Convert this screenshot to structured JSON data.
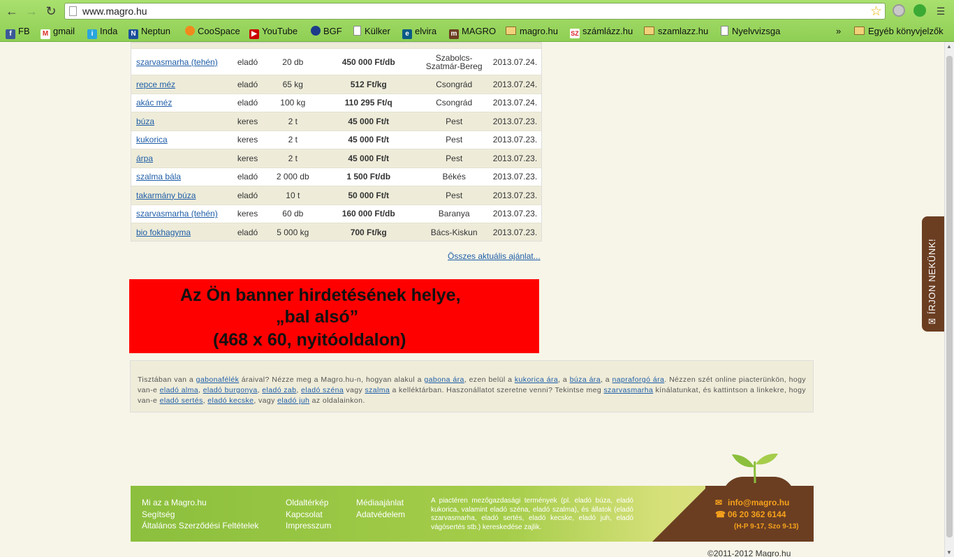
{
  "browser": {
    "url": "www.magro.hu",
    "bookmarks": [
      "FB",
      "gmail",
      "Inda",
      "Neptun",
      "CooSpace",
      "YouTube",
      "BGF",
      "Külker",
      "elvira",
      "MAGRO",
      "magro.hu",
      "számlázz.hu",
      "szamlazz.hu",
      "Nyelvvizsga"
    ],
    "overflow": "»",
    "other_bookmarks": "Egyéb könyvjelzők"
  },
  "listings": [
    {
      "name": "szarvasmarha (tehén)",
      "type": "eladó",
      "qty": "20 db",
      "price": "450 000 Ft/db",
      "region": "Szabolcs-Szatmár-Bereg",
      "date": "2013.07.24."
    },
    {
      "name": "repce méz",
      "type": "eladó",
      "qty": "65 kg",
      "price": "512 Ft/kg",
      "region": "Csongrád",
      "date": "2013.07.24."
    },
    {
      "name": "akác méz",
      "type": "eladó",
      "qty": "100 kg",
      "price": "110 295 Ft/q",
      "region": "Csongrád",
      "date": "2013.07.24."
    },
    {
      "name": "búza",
      "type": "keres",
      "qty": "2 t",
      "price": "45 000 Ft/t",
      "region": "Pest",
      "date": "2013.07.23."
    },
    {
      "name": "kukorica",
      "type": "keres",
      "qty": "2 t",
      "price": "45 000 Ft/t",
      "region": "Pest",
      "date": "2013.07.23."
    },
    {
      "name": "árpa",
      "type": "keres",
      "qty": "2 t",
      "price": "45 000 Ft/t",
      "region": "Pest",
      "date": "2013.07.23."
    },
    {
      "name": "szalma bála",
      "type": "eladó",
      "qty": "2 000 db",
      "price": "1 500 Ft/db",
      "region": "Békés",
      "date": "2013.07.23."
    },
    {
      "name": "takarmány búza",
      "type": "eladó",
      "qty": "10 t",
      "price": "50 000 Ft/t",
      "region": "Pest",
      "date": "2013.07.23."
    },
    {
      "name": "szarvasmarha (tehén)",
      "type": "keres",
      "qty": "60 db",
      "price": "160 000 Ft/db",
      "region": "Baranya",
      "date": "2013.07.23."
    },
    {
      "name": "bio fokhagyma",
      "type": "eladó",
      "qty": "5 000 kg",
      "price": "700 Ft/kg",
      "region": "Bács-Kiskun",
      "date": "2013.07.23."
    }
  ],
  "all_offers_link": "Összes aktuális ajánlat...",
  "banner": {
    "line1": "Az Ön banner hirdetésének helye,",
    "line2": "„bal alsó”",
    "line3": "(468 x 60, nyitóoldalon)"
  },
  "info": [
    {
      "t": "Tisztában van a "
    },
    {
      "l": "gabonafélék"
    },
    {
      "t": " áraival? Nézze meg a Magro.hu-n, hogyan alakul a "
    },
    {
      "l": "gabona ára"
    },
    {
      "t": ", ezen belül a "
    },
    {
      "l": "kukorica ára"
    },
    {
      "t": ", a "
    },
    {
      "l": "búza ára"
    },
    {
      "t": ", a "
    },
    {
      "l": "napraforgó ára"
    },
    {
      "t": ". Nézzen szét online piacterünkön, hogy van-e "
    },
    {
      "l": "eladó alma"
    },
    {
      "t": ", "
    },
    {
      "l": "eladó burgonya"
    },
    {
      "t": ", "
    },
    {
      "l": "eladó zab"
    },
    {
      "t": ", "
    },
    {
      "l": "eladó széna"
    },
    {
      "t": " vagy "
    },
    {
      "l": "szalma"
    },
    {
      "t": " a kelléktárban. Haszonállatot szeretne venni? Tekintse meg "
    },
    {
      "l": "szarvasmarha"
    },
    {
      "t": " kínálatunkat, és kattintson a linkekre, hogy van-e "
    },
    {
      "l": "eladó sertés"
    },
    {
      "t": ", "
    },
    {
      "l": "eladó kecske"
    },
    {
      "t": ", vagy "
    },
    {
      "l": "eladó juh"
    },
    {
      "t": " az oldalainkon."
    }
  ],
  "footer": {
    "col1": [
      "Mi az a Magro.hu",
      "Segítség",
      "Általános Szerződési Feltételek"
    ],
    "col2": [
      "Oldaltérkép",
      "Kapcsolat",
      "Impresszum"
    ],
    "col3": [
      "Médiaajánlat",
      "Adatvédelem"
    ],
    "description": "A piactéren mezőgazdasági termények (pl. eladó búza, eladó kukorica, valamint eladó széna, eladó szalma), és állatok (eladó szarvasmarha, eladó sertés, eladó kecske, eladó juh, eladó vágósertés stb.) kereskedése zajlik.",
    "email": "info@magro.hu",
    "phone": "06 20 362 6144",
    "hours": "(H-P 9-17, Szo 9-13)",
    "copyright": "©2011-2012 Magro.hu"
  },
  "side_tab": "ÍRJON NEKÜNK!",
  "colors": {
    "brand_green": "#8bbf3d",
    "brand_brown": "#6b3e22",
    "banner_red": "#ff0000",
    "link_blue": "#1f5ea8",
    "accent_orange": "#f7a21b"
  }
}
